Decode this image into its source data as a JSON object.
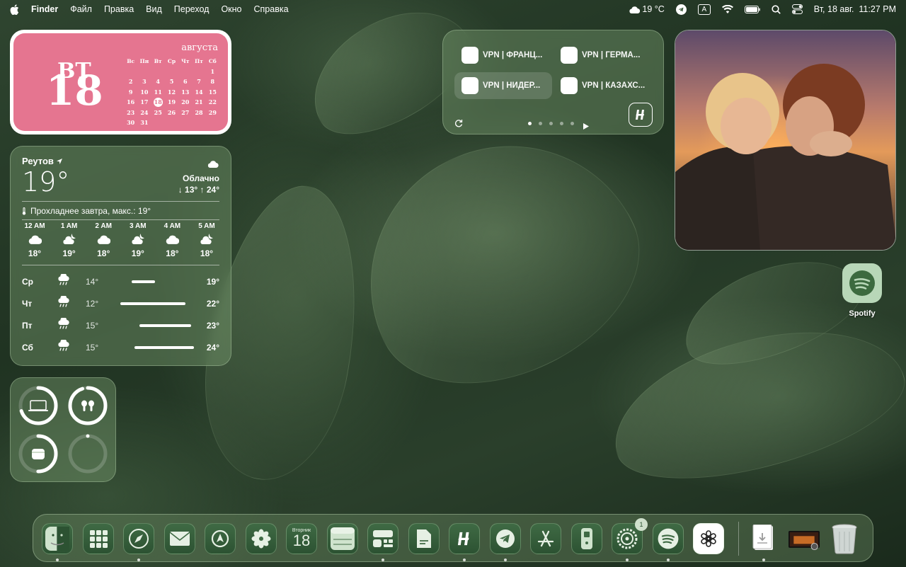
{
  "menubar": {
    "app": "Finder",
    "items": [
      "Файл",
      "Правка",
      "Вид",
      "Переход",
      "Окно",
      "Справка"
    ],
    "weather": "19 °C",
    "input_source": "A",
    "datetime": "Вт, 18 авг.  11:27 PM"
  },
  "calendar": {
    "weekday": "ВТ",
    "day": "18",
    "month": "августа",
    "headers": [
      "Вс",
      "Пн",
      "Вт",
      "Ср",
      "Чт",
      "Пт",
      "Сб"
    ],
    "weeks": [
      [
        "",
        "",
        "",
        "",
        "",
        "",
        "1"
      ],
      [
        "2",
        "3",
        "4",
        "5",
        "6",
        "7",
        "8"
      ],
      [
        "9",
        "10",
        "11",
        "12",
        "13",
        "14",
        "15"
      ],
      [
        "16",
        "17",
        "18",
        "19",
        "20",
        "21",
        "22"
      ],
      [
        "23",
        "24",
        "25",
        "26",
        "27",
        "28",
        "29"
      ],
      [
        "30",
        "31",
        "",
        "",
        "",
        "",
        ""
      ]
    ],
    "today": "18"
  },
  "weather": {
    "city": "Реутов",
    "temp": "19°",
    "condition": "Облачно",
    "hilo": "↓ 13° ↑ 24°",
    "note": "Прохладнее завтра, макс.: 19°",
    "hours": [
      {
        "time": "12 AM",
        "icon": "cloud-icon",
        "temp": "18°"
      },
      {
        "time": "1 AM",
        "icon": "cloud-moon-icon",
        "temp": "19°"
      },
      {
        "time": "2 AM",
        "icon": "cloud-icon",
        "temp": "18°"
      },
      {
        "time": "3 AM",
        "icon": "cloud-moon-icon",
        "temp": "19°"
      },
      {
        "time": "4 AM",
        "icon": "cloud-icon",
        "temp": "18°"
      },
      {
        "time": "5 AM",
        "icon": "cloud-moon-icon",
        "temp": "18°"
      }
    ],
    "days": [
      {
        "name": "Ср",
        "icon": "cloud-rain-icon",
        "low": "14°",
        "high": "19°",
        "bar_start": 0.2,
        "bar_end": 0.5
      },
      {
        "name": "Чт",
        "icon": "cloud-rain-icon",
        "low": "12°",
        "high": "22°",
        "bar_start": 0.06,
        "bar_end": 0.88
      },
      {
        "name": "Пт",
        "icon": "cloud-rain-icon",
        "low": "15°",
        "high": "23°",
        "bar_start": 0.3,
        "bar_end": 0.95
      },
      {
        "name": "Сб",
        "icon": "cloud-rain-icon",
        "low": "15°",
        "high": "24°",
        "bar_start": 0.24,
        "bar_end": 0.98
      }
    ]
  },
  "battery": {
    "devices": [
      {
        "icon": "laptop-icon",
        "level": 0.7
      },
      {
        "icon": "airpods-icon",
        "level": 0.95
      },
      {
        "icon": "airpods-case-icon",
        "level": 0.5
      },
      {
        "icon": "empty-slot-icon",
        "level": 0
      }
    ]
  },
  "vpn": {
    "items": [
      "VPN | ФРАНЦ...",
      "VPN | ГЕРМА...",
      "VPN | НИДЕР...",
      "VPN | КАЗАХС..."
    ],
    "active_index": 2,
    "pages": 5,
    "current_page": 0
  },
  "desktop": {
    "spotify_label": "Spotify"
  },
  "dock": {
    "calendar_weekday": "Вторник",
    "calendar_day": "18",
    "settings_badge": "1",
    "apps": [
      "finder-icon",
      "launchpad-icon",
      "safari-icon",
      "mail-icon",
      "maps-icon",
      "photos-icon",
      "calendar-icon",
      "notes-icon",
      "widgets-icon",
      "pages-icon",
      "hiddify-icon",
      "telegram-icon",
      "app-store-icon",
      "remote-icon",
      "system-settings-icon",
      "spotify-icon",
      "chatgpt-icon",
      "downloads-icon",
      "screen-saver-icon",
      "trash-icon"
    ]
  },
  "colors": {
    "calendar_pink": "#e57590",
    "glass": "#7da073"
  }
}
